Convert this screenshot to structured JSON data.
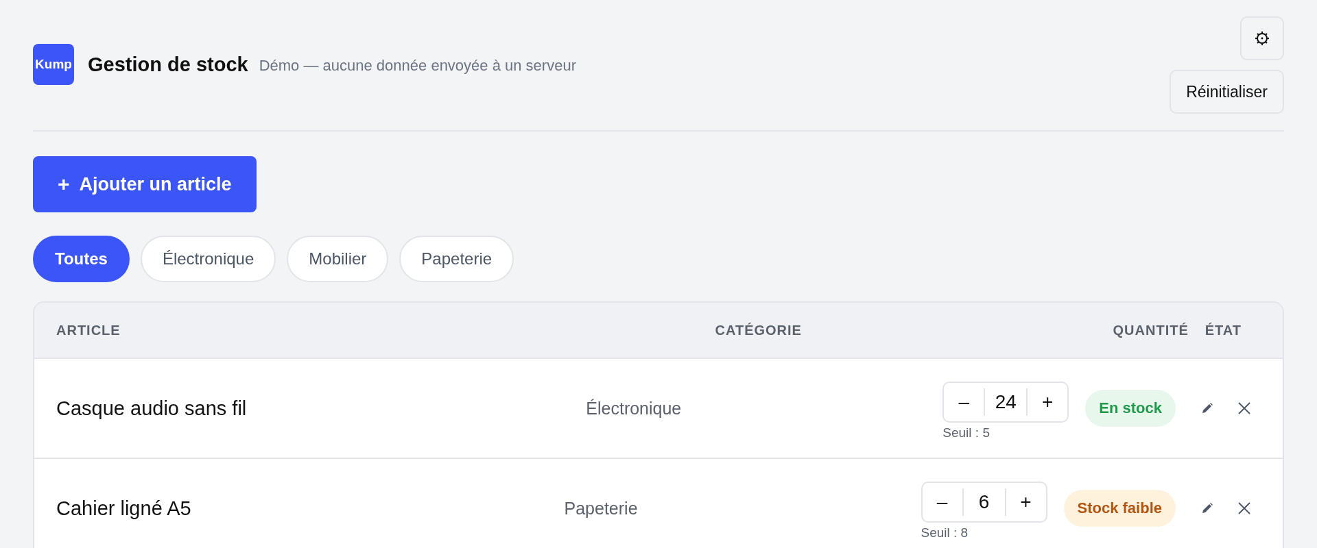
{
  "header": {
    "logo": "Kump",
    "title": "Gestion de stock",
    "subtitle": "Démo — aucune donnée envoyée à un serveur",
    "reset_button": "Réinitialiser"
  },
  "add_button": {
    "icon": "+",
    "label": "Ajouter un article"
  },
  "filters": [
    {
      "label": "Toutes",
      "selected": true
    },
    {
      "label": "Électronique",
      "selected": false
    },
    {
      "label": "Mobilier",
      "selected": false
    },
    {
      "label": "Papeterie",
      "selected": false
    }
  ],
  "table": {
    "columns": [
      "ARTICLE",
      "CATÉGORIE",
      "QUANTITÉ",
      "ÉTAT"
    ],
    "rows": [
      {
        "name": "Casque audio sans fil",
        "category": "Électronique",
        "decrement": "–",
        "quantity": "24",
        "increment": "+",
        "threshold": "Seuil : 5",
        "status": {
          "kind": "ok",
          "label": "En stock"
        }
      },
      {
        "name": "Cahier ligné A5",
        "category": "Papeterie",
        "decrement": "–",
        "quantity": "6",
        "increment": "+",
        "threshold": "Seuil : 8",
        "status": {
          "kind": "low",
          "label": "Stock faible"
        }
      }
    ]
  }
}
